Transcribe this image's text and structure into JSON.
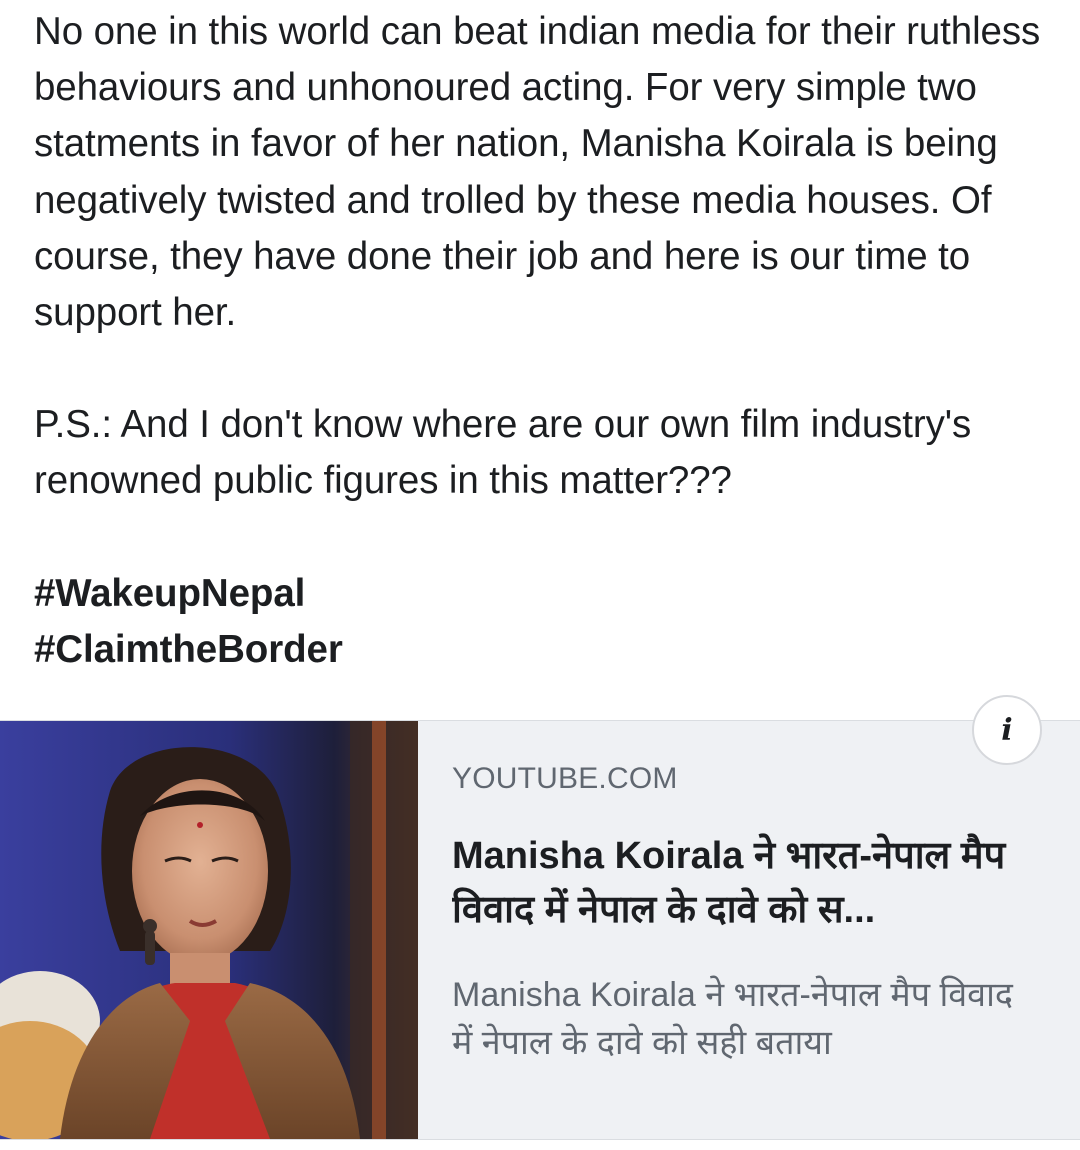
{
  "post": {
    "paragraph_1": "No one in this world can beat indian media for their ruthless behaviours and unhonoured acting. For very simple two statments in favor of her nation, Manisha Koirala is being negatively twisted and trolled by these media houses. Of course, they have done their job and here is our time to support her.",
    "paragraph_2": "P.S.: And I don't know where are our own film industry's renowned public figures in this matter???",
    "hashtags": [
      "#WakeupNepal",
      "#ClaimtheBorder"
    ]
  },
  "link_card": {
    "domain": "YOUTUBE.COM",
    "title": "Manisha Koirala ने भारत-नेपाल मैप विवाद में नेपाल के दावे को स...",
    "description": "Manisha Koirala ने भारत-नेपाल मैप विवाद में नेपाल के दावे को सही बताया",
    "info_icon_glyph": "i",
    "info_icon": "info-icon",
    "colors": {
      "card_background": "#eff1f4",
      "domain_text": "#606770",
      "title_text": "#1c1e21"
    }
  }
}
